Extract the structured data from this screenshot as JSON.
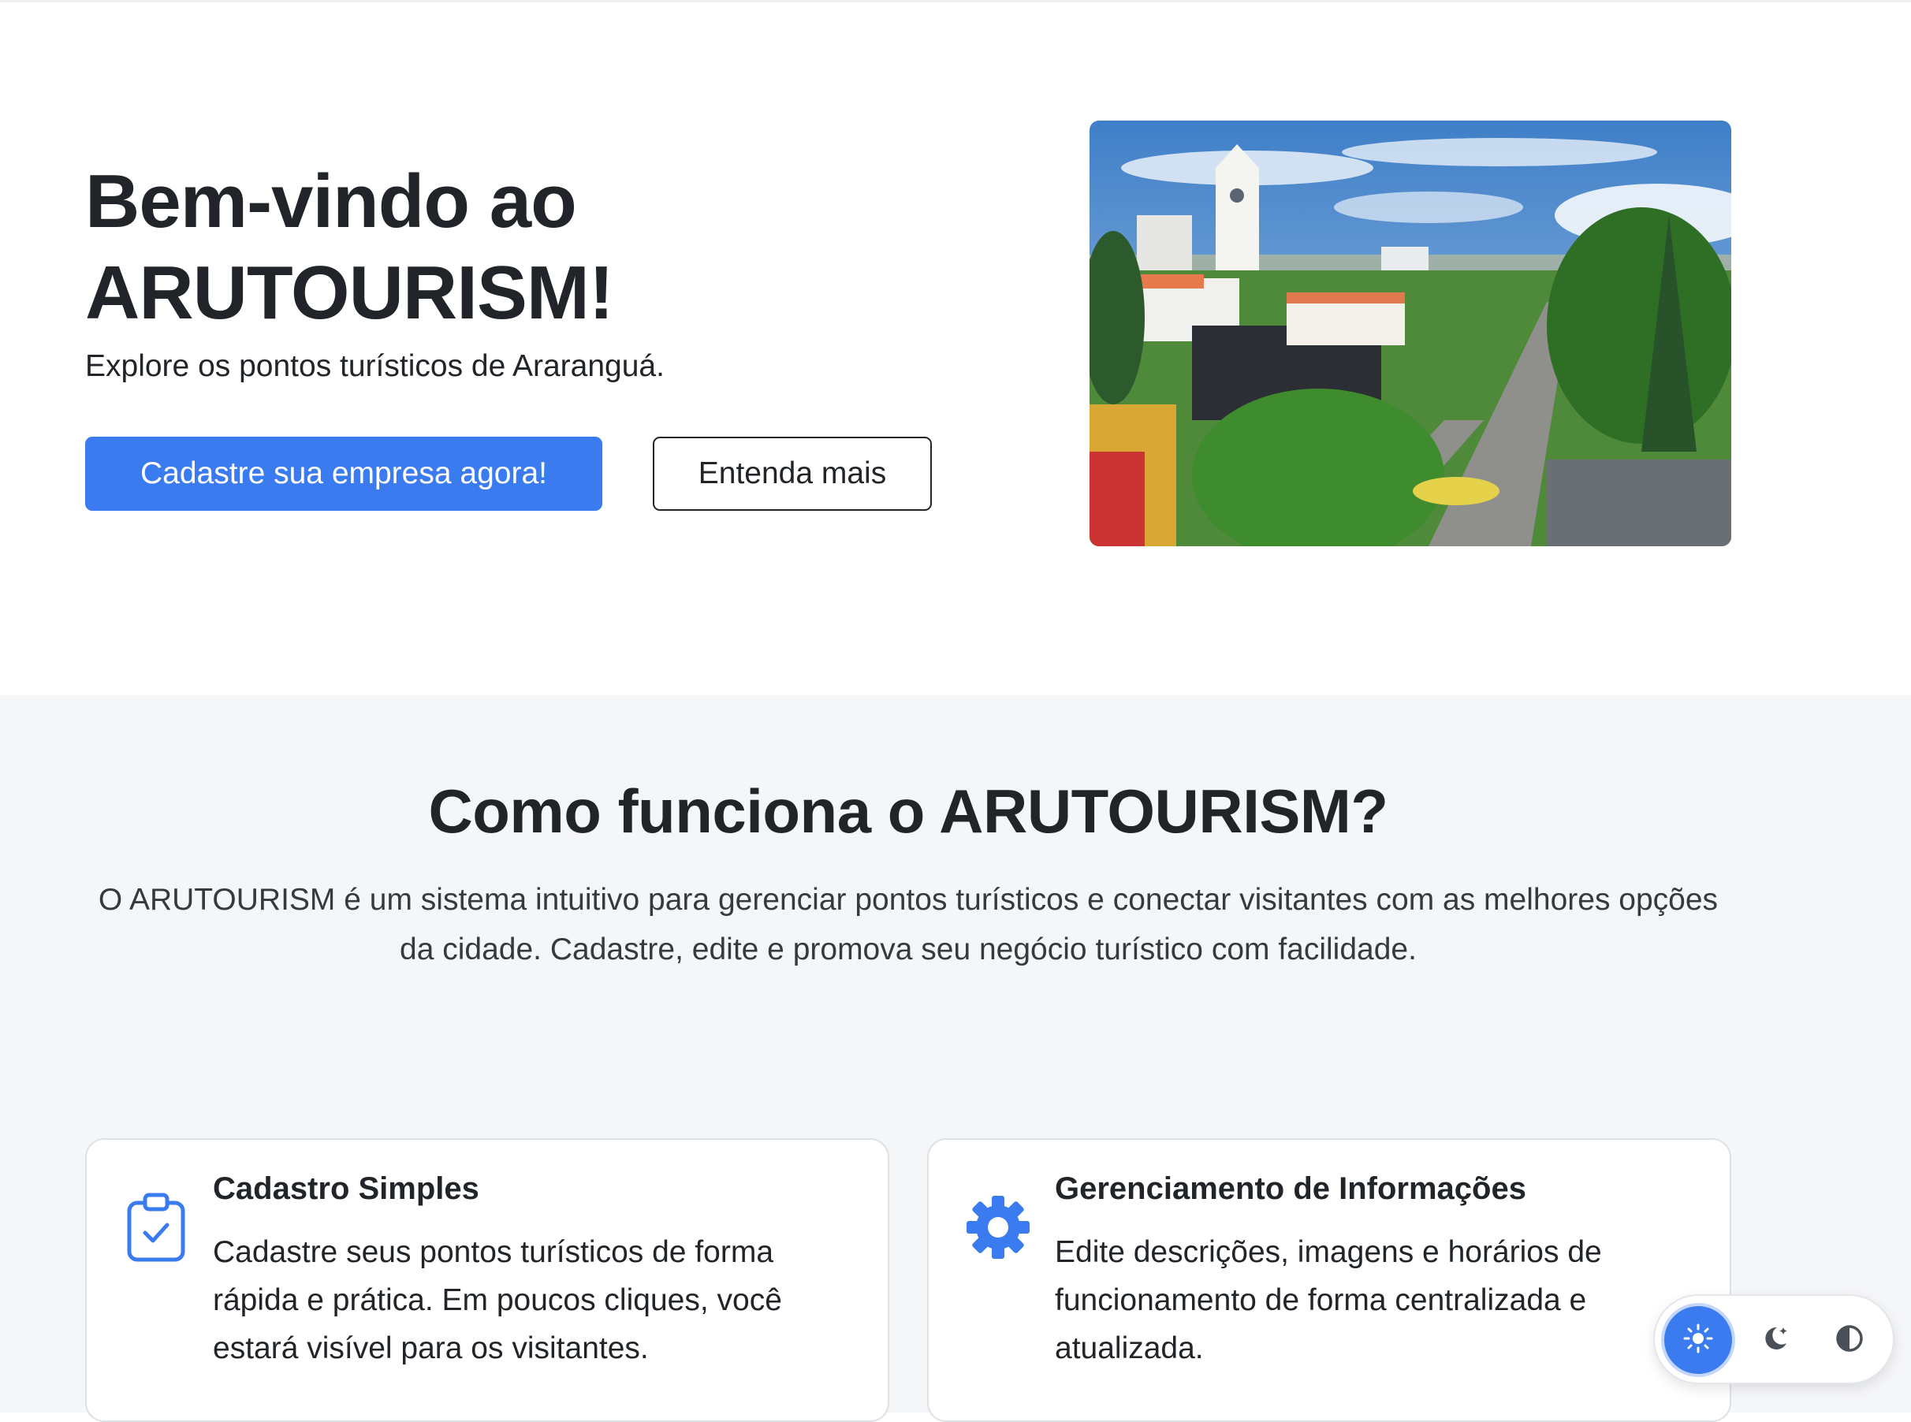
{
  "hero": {
    "title_line1": "Bem-vindo ao",
    "title_line2": "ARUTOURISM!",
    "subtitle": "Explore os pontos turísticos de Araranguá.",
    "primary_button": "Cadastre sua empresa agora!",
    "secondary_button": "Entenda mais",
    "image_icon": "city-photo"
  },
  "how": {
    "title": "Como funciona o ARUTOURISM?",
    "description": "O ARUTOURISM é um sistema intuitivo para gerenciar pontos turísticos e conectar visitantes com as melhores opções da cidade. Cadastre, edite e promova seu negócio turístico com facilidade."
  },
  "features": [
    {
      "icon": "clipboard-check-icon",
      "title": "Cadastro Simples",
      "text": "Cadastre seus pontos turísticos de forma rápida e prática. Em poucos cliques, você estará visível para os visitantes."
    },
    {
      "icon": "gear-icon",
      "title": "Gerenciamento de Informações",
      "text": "Edite descrições, imagens e horários de funcionamento de forma centralizada e atualizada."
    }
  ],
  "theme_switcher": {
    "options": [
      "sun-icon",
      "moon-stars-icon",
      "contrast-icon"
    ],
    "selected": "light"
  },
  "colors": {
    "accent": "#3a7bf0",
    "text": "#212529",
    "section_bg": "#f5f6f8"
  }
}
